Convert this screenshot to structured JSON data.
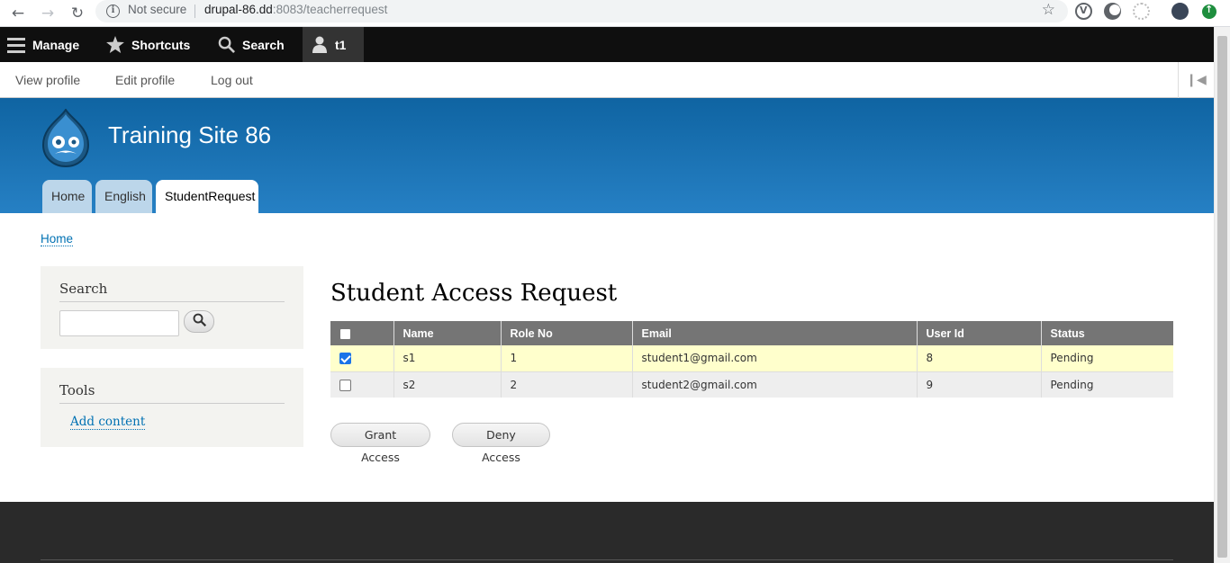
{
  "browser": {
    "not_secure": "Not secure",
    "url_host": "drupal-86.dd",
    "url_rest": ":8083/teacherrequest"
  },
  "toolbar": {
    "manage": "Manage",
    "shortcuts": "Shortcuts",
    "search": "Search",
    "user": "t1"
  },
  "tray": {
    "view_profile": "View profile",
    "edit_profile": "Edit profile",
    "log_out": "Log out"
  },
  "header": {
    "site_name": "Training Site 86",
    "tabs": [
      "Home",
      "English",
      "StudentRequest"
    ],
    "active_tab": "StudentRequest"
  },
  "breadcrumb": "Home",
  "sidebar": {
    "search_title": "Search",
    "search_value": "",
    "tools_title": "Tools",
    "tools_link": "Add content"
  },
  "main": {
    "title": "Student Access Request",
    "columns": [
      "Name",
      "Role No",
      "Email",
      "User Id",
      "Status"
    ],
    "rows": [
      {
        "checked": true,
        "name": "s1",
        "role_no": "1",
        "email": "student1@gmail.com",
        "user_id": "8",
        "status": "Pending"
      },
      {
        "checked": false,
        "name": "s2",
        "role_no": "2",
        "email": "student2@gmail.com",
        "user_id": "9",
        "status": "Pending"
      }
    ],
    "grant_button": "Grant Access",
    "deny_button": "Deny Access"
  },
  "colors": {
    "toolbar_bg": "#0f0f0f",
    "header_top": "#0f64a2",
    "header_bottom": "#2680c4",
    "link": "#0071b3",
    "table_header": "#757575",
    "selected_row": "#ffffcc"
  }
}
